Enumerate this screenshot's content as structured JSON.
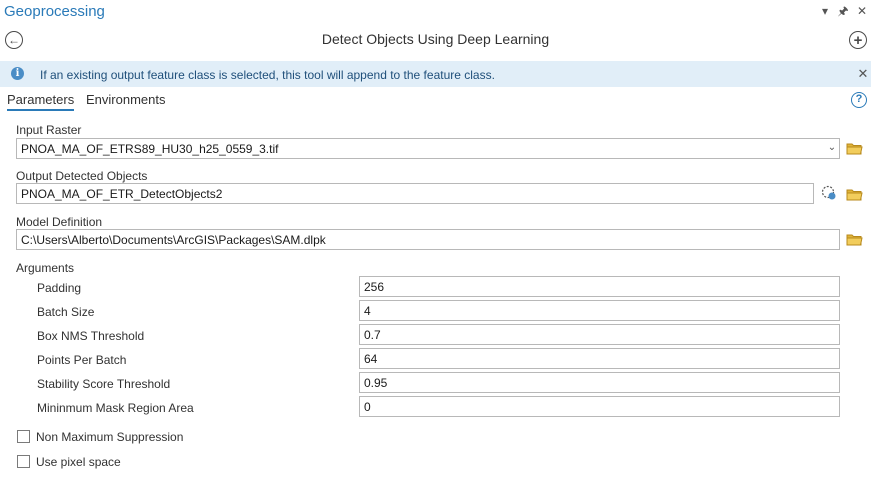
{
  "pane": {
    "title": "Geoprocessing",
    "tool_title": "Detect Objects Using Deep Learning",
    "icons": [
      "chevron-down-icon",
      "pin-icon",
      "close-icon",
      "back-icon",
      "add-icon"
    ]
  },
  "banner": {
    "message": "If an existing output feature class is selected, this tool will append to the feature class.",
    "icon": "info-icon",
    "background": "#e1eef8"
  },
  "tabs": {
    "parameters": "Parameters",
    "environments": "Environments",
    "active": "Parameters",
    "help_icon": "?"
  },
  "fields": {
    "input_raster": {
      "label": "Input Raster",
      "value": "PNOA_MA_OF_ETRS89_HU30_h25_0559_3.tif"
    },
    "output_detected_objects": {
      "label": "Output Detected Objects",
      "value": "PNOA_MA_OF_ETR_DetectObjects2"
    },
    "model_definition": {
      "label": "Model Definition",
      "value": "C:\\Users\\Alberto\\Documents\\ArcGIS\\Packages\\SAM.dlpk"
    }
  },
  "arguments": {
    "label": "Arguments",
    "rows": [
      {
        "name": "Padding",
        "value": "256"
      },
      {
        "name": "Batch Size",
        "value": "4"
      },
      {
        "name": "Box NMS Threshold",
        "value": "0.7"
      },
      {
        "name": "Points Per Batch",
        "value": "64"
      },
      {
        "name": "Stability Score Threshold",
        "value": "0.95"
      },
      {
        "name": "Mininmum Mask Region Area",
        "value": "0"
      }
    ]
  },
  "options": {
    "non_max_suppression": {
      "label": "Non Maximum Suppression",
      "checked": false
    },
    "use_pixel_space": {
      "label": "Use pixel space",
      "checked": false
    }
  },
  "colors": {
    "accent": "#2a7ab8",
    "folder": "#e0b43a"
  }
}
